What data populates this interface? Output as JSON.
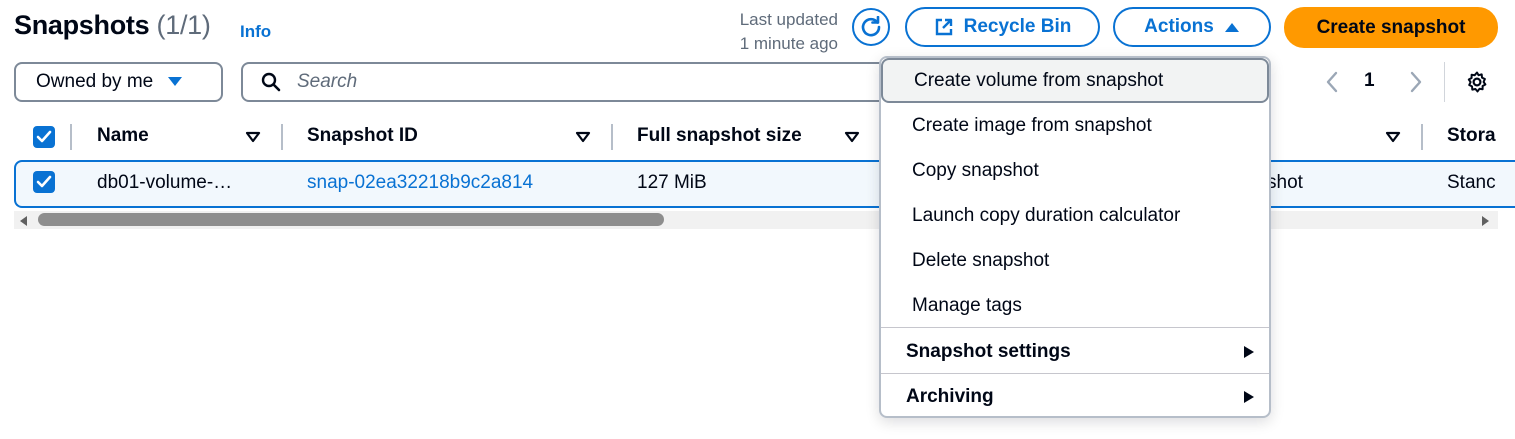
{
  "header": {
    "title": "Snapshots",
    "count": "(1/1)",
    "info": "Info",
    "last_updated_line1": "Last updated",
    "last_updated_line2": "1 minute ago",
    "recycle_bin": "Recycle Bin",
    "actions": "Actions",
    "create_snapshot": "Create snapshot"
  },
  "filters": {
    "owner": "Owned by me",
    "search_placeholder": "Search"
  },
  "pagination": {
    "page": "1"
  },
  "table": {
    "columns": [
      "Name",
      "Snapshot ID",
      "Full snapshot size",
      "Stora"
    ],
    "rows": [
      {
        "name": "db01-volume-…",
        "snapshot_id": "snap-02ea32218b9c2a814",
        "size": "127 MiB",
        "description_partial": "shot",
        "storage_partial": "Stanc"
      }
    ]
  },
  "actions_menu": {
    "items": [
      "Create volume from snapshot",
      "Create image from snapshot",
      "Copy snapshot",
      "Launch copy duration calculator",
      "Delete snapshot",
      "Manage tags"
    ],
    "groups": [
      "Snapshot settings",
      "Archiving"
    ]
  },
  "colors": {
    "accent": "#0972d3",
    "primary_button": "#ff9900",
    "text": "#000716",
    "muted": "#5f6b7a"
  },
  "icons": [
    "refresh-icon",
    "external-link-icon",
    "caret-up-icon",
    "caret-down-icon",
    "search-icon",
    "chevron-left-icon",
    "chevron-right-icon",
    "gear-icon",
    "sort-icon",
    "check-icon",
    "caret-right-icon"
  ]
}
